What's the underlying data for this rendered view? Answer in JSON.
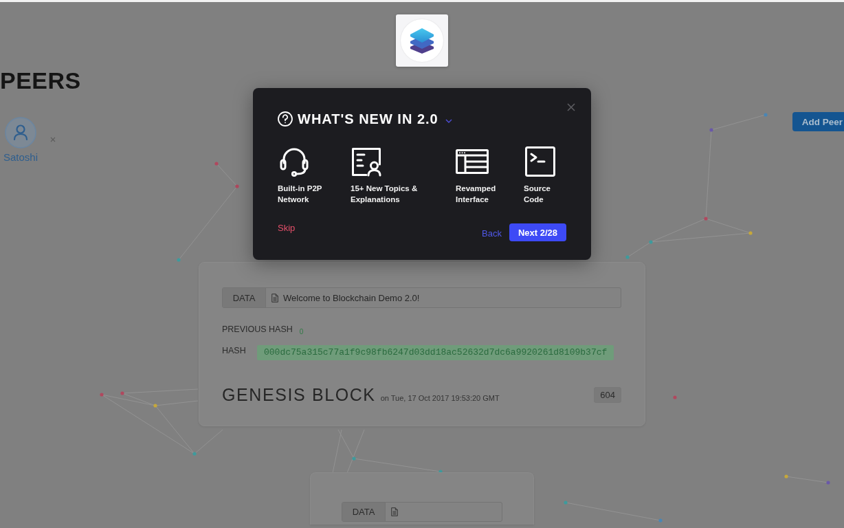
{
  "peers": {
    "title": "PEERS",
    "items": [
      {
        "name": "Satoshi"
      }
    ],
    "add_button": "Add Peer"
  },
  "modal": {
    "title": "WHAT'S NEW IN 2.0",
    "features": [
      {
        "label": "Built-in P2P Network"
      },
      {
        "label": "15+ New Topics & Explanations"
      },
      {
        "label": "Revamped Interface"
      },
      {
        "label": "Source Code"
      }
    ],
    "skip": "Skip",
    "back": "Back",
    "next": "Next 2/28"
  },
  "blocks": [
    {
      "data_label": "DATA",
      "data": "Welcome to Blockchain Demo 2.0!",
      "previous_hash_label": "PREVIOUS HASH",
      "previous_hash": "0",
      "hash_label": "HASH",
      "hash": "000dc75a315c77a1f9c98fb6247d03dd18ac52632d7dc6a9920261d8109b37cf",
      "hash_valid": true,
      "title": "GENESIS BLOCK",
      "timestamp": "on Tue, 17 Oct 2017 19:53:20 GMT",
      "nonce": "604"
    },
    {
      "data_label": "DATA"
    }
  ]
}
